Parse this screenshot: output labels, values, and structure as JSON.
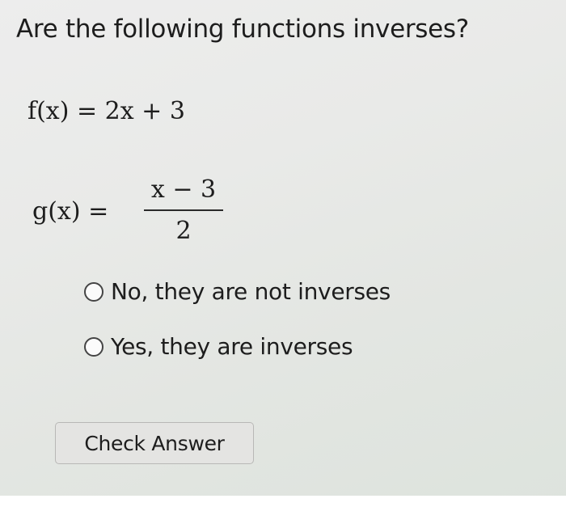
{
  "question": "Are the following functions inverses?",
  "functions": {
    "f": "f(x) = 2x + 3",
    "g_lhs": "g(x) =",
    "g_numerator": "x − 3",
    "g_denominator": "2"
  },
  "options": [
    {
      "label": "No, they are not inverses",
      "selected": false
    },
    {
      "label": "Yes, they are inverses",
      "selected": false
    }
  ],
  "check_button_label": "Check Answer"
}
